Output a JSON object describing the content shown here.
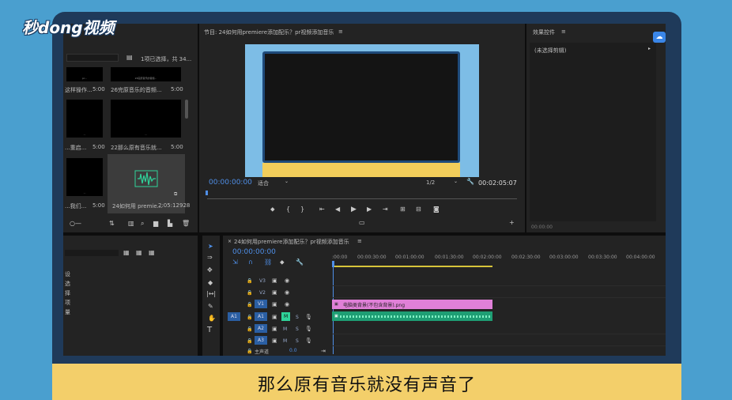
{
  "watermark": {
    "text": "秒dong视频"
  },
  "subtitle": "那么原有音乐就没有声音了",
  "project": {
    "search_placeholder": "",
    "selection_info": "1项已选择，共 34...",
    "items": [
      {
        "label": "这样操作...",
        "duration": "5:00",
        "thumb_caption": "pr..."
      },
      {
        "label": "26完原音乐的音频...",
        "duration": "5:00",
        "thumb_caption": "26完原音乐的音频..."
      },
      {
        "label": "...重启...",
        "duration": "5:00",
        "thumb_caption": "..."
      },
      {
        "label": "22那么原有音乐就...",
        "duration": "5:00",
        "thumb_caption": "..."
      },
      {
        "label": "...我们...",
        "duration": "5:00",
        "thumb_caption": "..."
      },
      {
        "label": "24如何用 premie...",
        "duration": "2:05:12928",
        "thumb_caption": ""
      }
    ]
  },
  "program": {
    "title": "节目: 24如何用premiere添加配乐？pr视频添加音乐",
    "menu_icon": "≡",
    "timecode": "00:00:00:00",
    "fit": "适合",
    "resolution": "1/2",
    "duration": "00:02:05:07"
  },
  "effects": {
    "title": "效果控件",
    "menu_icon": "≡",
    "no_clip": "(未选择剪辑)",
    "timecode": "00:00:00"
  },
  "left_bottom": {
    "items": [
      "设",
      "选",
      "择",
      "项",
      "量"
    ],
    "partial_header": "设"
  },
  "timeline": {
    "title": "24如何用premiere添加配乐？pr视频添加音乐",
    "menu_icon": "≡",
    "timecode": "00:00:00:00",
    "ruler": [
      ":00:00",
      "00:00:30:00",
      "00:01:00:00",
      "00:01:30:00",
      "00:02:00:00",
      "00:02:30:00",
      "00:03:00:00",
      "00:03:30:00",
      "00:04:00:00"
    ],
    "tracks": [
      {
        "name": "V3",
        "type": "video"
      },
      {
        "name": "V2",
        "type": "video"
      },
      {
        "name": "V1",
        "type": "video"
      },
      {
        "name": "A1",
        "type": "audio",
        "src": "A1"
      },
      {
        "name": "A2",
        "type": "audio"
      },
      {
        "name": "A3",
        "type": "audio"
      }
    ],
    "master_label": "主声道",
    "master_value": "0.0",
    "video_clip": "电脑类背景(不包含背景).png",
    "audio_clip_label": "fx",
    "m_label": "M",
    "s_label": "S"
  }
}
